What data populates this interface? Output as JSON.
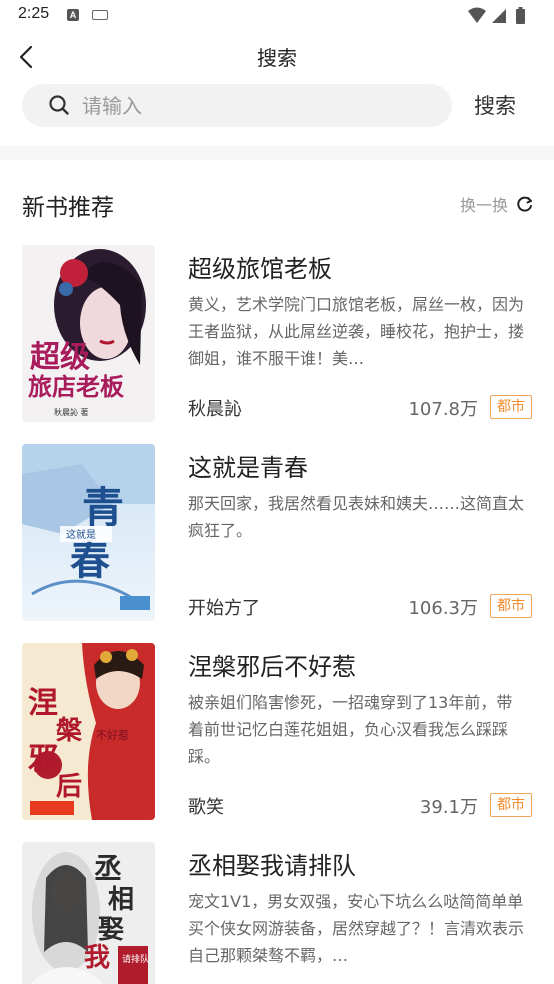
{
  "status_bar": {
    "time": "2:25",
    "notification_letter": "A"
  },
  "nav": {
    "title": "搜索"
  },
  "search": {
    "placeholder": "请输入",
    "value": "",
    "button_label": "搜索"
  },
  "section": {
    "title": "新书推荐",
    "refresh_label": "换一换"
  },
  "books": [
    {
      "title": "超级旅馆老板",
      "description": "黄义，艺术学院门口旅馆老板，屌丝一枚，因为王者监狱，从此屌丝逆袭，睡校花，抱护士，搂御姐，谁不服干谁！美…",
      "author": "秋晨訫",
      "count": "107.8万",
      "tag": "都市",
      "cover_text": "超级旅店老板",
      "cover_subtext": "秋晨訫 著"
    },
    {
      "title": "这就是青春",
      "description": "那天回家，我居然看见表妹和姨夫……这简直太疯狂了。",
      "author": "开始方了",
      "count": "106.3万",
      "tag": "都市",
      "cover_text": "青春",
      "cover_subtext": "这就是"
    },
    {
      "title": "涅槃邪后不好惹",
      "description": "被亲姐们陷害惨死，一招魂穿到了13年前，带着前世记忆白莲花姐姐，负心汉看我怎么踩踩踩。",
      "author": "歌笑",
      "count": "39.1万",
      "tag": "都市",
      "cover_text": "涅槃邪后",
      "cover_subtext": "不好惹"
    },
    {
      "title": "丞相娶我请排队",
      "description": "宠文1V1，男女双强，安心下坑么么哒简简单单买个侠女网游装备，居然穿越了？！言清欢表示自己那颗桀骜不羁，…",
      "author": "",
      "count": "",
      "tag": "",
      "cover_text": "丞相娶我",
      "cover_subtext": "请排队"
    }
  ],
  "colors": {
    "tag_border": "#f2a65a",
    "tag_text": "#f08c2c",
    "search_bg": "#f2f2f2",
    "divider": "#f6f6f6"
  }
}
